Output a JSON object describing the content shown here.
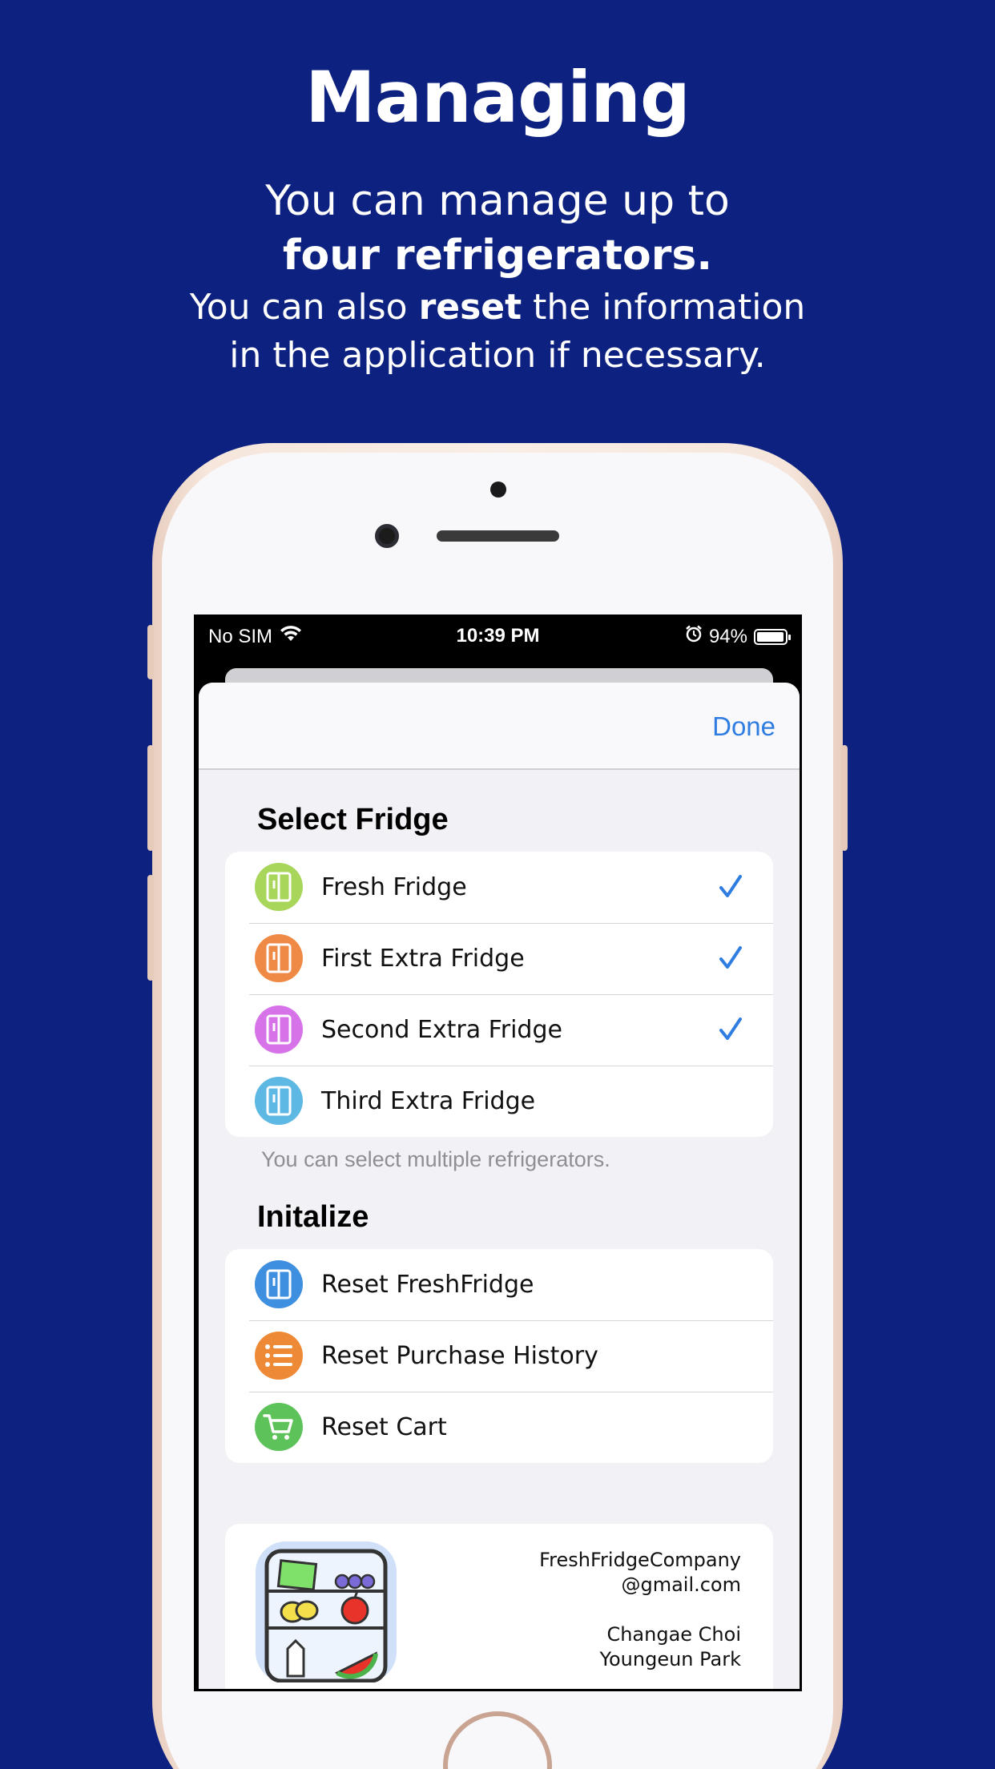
{
  "promo": {
    "headline": "Managing",
    "line1": "You can manage up to",
    "line2": "four refrigerators.",
    "line3_pre": "You can also ",
    "line3_bold": "reset",
    "line3_post": " the information",
    "line4": "in the application if necessary."
  },
  "statusbar": {
    "carrier": "No SIM",
    "time": "10:39 PM",
    "battery": "94%",
    "battery_level": 0.94
  },
  "nav": {
    "done_label": "Done"
  },
  "select_fridge": {
    "title": "Select Fridge",
    "items": [
      {
        "label": "Fresh Fridge",
        "icon": "fridge-icon",
        "color": "#a8d65a",
        "checked": true
      },
      {
        "label": "First Extra Fridge",
        "icon": "fridge-icon",
        "color": "#ee8a45",
        "checked": true
      },
      {
        "label": "Second Extra Fridge",
        "icon": "fridge-icon",
        "color": "#d673e8",
        "checked": true
      },
      {
        "label": "Third Extra Fridge",
        "icon": "fridge-icon",
        "color": "#5db8e4",
        "checked": false
      }
    ],
    "footnote": "You can select multiple refrigerators."
  },
  "initialize": {
    "title": "Initalize",
    "items": [
      {
        "label": "Reset FreshFridge",
        "icon": "fridge-icon",
        "color": "#3f8fe0"
      },
      {
        "label": "Reset Purchase History",
        "icon": "list-icon",
        "color": "#ee8a35"
      },
      {
        "label": "Reset Cart",
        "icon": "cart-icon",
        "color": "#5ec25a"
      }
    ]
  },
  "credits": {
    "email_line1": "FreshFridgeCompany",
    "email_line2": "@gmail.com",
    "author1": "Changae Choi",
    "author2": "Youngeun Park"
  },
  "colors": {
    "background": "#0d2180",
    "accent": "#2f7de1"
  }
}
